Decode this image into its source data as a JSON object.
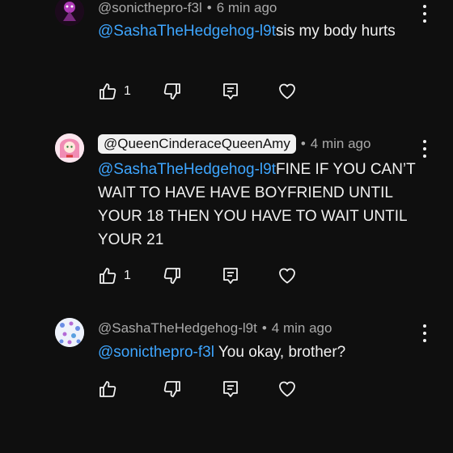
{
  "comments": [
    {
      "handle": "@sonicthepro-f3l",
      "time": "6 min ago",
      "mention": "@SashaTheHedgehog-l9t",
      "text": "sis my body hurts",
      "likes": "1"
    },
    {
      "handle": "@QueenCinderaceQueenAmy",
      "time": "4 min ago",
      "mention": "@SashaTheHedgehog-l9t",
      "text": "FINE IF YOU CAN’T WAIT TO HAVE HAVE BOYFRIEND UNTIL YOUR 18 THEN YOU HAVE TO WAIT UNTIL YOUR 21",
      "likes": "1"
    },
    {
      "handle": "@SashaTheHedgehog-l9t",
      "time": "4 min ago",
      "mention": "@sonicthepro-f3l",
      "text": " You okay, brother?",
      "likes": ""
    }
  ],
  "separator": "•",
  "colors": {
    "background": "#0f0f0f",
    "mention": "#3ea6ff",
    "meta": "#aaaaaa",
    "text": "#f1f1f1"
  },
  "icons": [
    "like-icon",
    "dislike-icon",
    "reply-icon",
    "heart-icon",
    "more-vert-icon"
  ]
}
